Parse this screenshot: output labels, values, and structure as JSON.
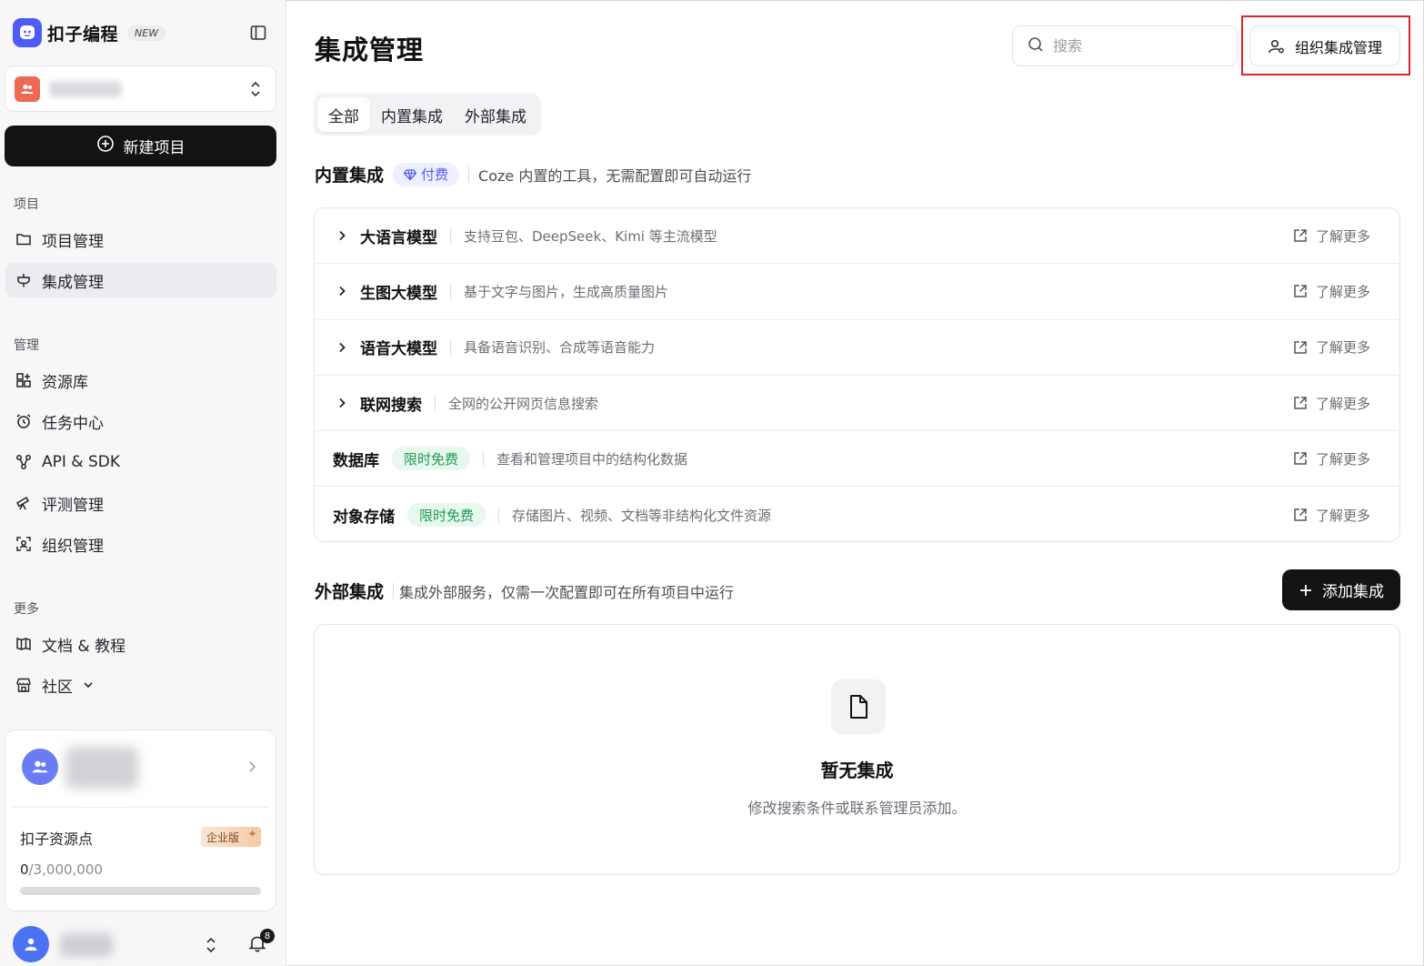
{
  "brand": {
    "name": "扣子编程",
    "badge": "NEW"
  },
  "sidebar": {
    "new_project_label": "新建项目",
    "sections": [
      {
        "title": "项目",
        "items": [
          {
            "label": "项目管理",
            "icon": "folder-icon"
          },
          {
            "label": "集成管理",
            "icon": "plug-icon",
            "active": true
          }
        ]
      },
      {
        "title": "管理",
        "items": [
          {
            "label": "资源库",
            "icon": "grid-plus-icon"
          },
          {
            "label": "任务中心",
            "icon": "alarm-clock-icon"
          },
          {
            "label": "API & SDK",
            "icon": "nodes-icon"
          },
          {
            "label": "评测管理",
            "icon": "telescope-icon"
          },
          {
            "label": "组织管理",
            "icon": "org-scan-icon"
          }
        ]
      },
      {
        "title": "更多",
        "items": [
          {
            "label": "文档 & 教程",
            "icon": "book-icon"
          },
          {
            "label": "社区",
            "icon": "store-icon"
          }
        ]
      }
    ],
    "account": {
      "points_label": "扣子资源点",
      "edition_badge": "企业版",
      "points_used": "0",
      "points_total": "/3,000,000",
      "points_fraction": 0
    },
    "notifications_count": "8"
  },
  "header": {
    "title": "集成管理",
    "search_placeholder": "搜索",
    "org_manage_label": "组织集成管理"
  },
  "tabs": [
    {
      "label": "全部",
      "active": true
    },
    {
      "label": "内置集成"
    },
    {
      "label": "外部集成"
    }
  ],
  "builtin": {
    "title": "内置集成",
    "paid_badge": "付费",
    "desc": "Coze 内置的工具，无需配置即可自动运行",
    "rows": [
      {
        "name": "大语言模型",
        "desc": "支持豆包、DeepSeek、Kimi 等主流模型",
        "expandable": true,
        "learn_more": "了解更多"
      },
      {
        "name": "生图大模型",
        "desc": "基于文字与图片，生成高质量图片",
        "expandable": true,
        "learn_more": "了解更多"
      },
      {
        "name": "语音大模型",
        "desc": "具备语音识别、合成等语音能力",
        "expandable": true,
        "learn_more": "了解更多"
      },
      {
        "name": "联网搜索",
        "desc": "全网的公开网页信息搜索",
        "expandable": true,
        "learn_more": "了解更多"
      },
      {
        "name": "数据库",
        "badge": "限时免费",
        "desc": "查看和管理项目中的结构化数据",
        "expandable": false,
        "learn_more": "了解更多"
      },
      {
        "name": "对象存储",
        "badge": "限时免费",
        "desc": "存储图片、视频、文档等非结构化文件资源",
        "expandable": false,
        "learn_more": "了解更多"
      }
    ]
  },
  "external": {
    "title": "外部集成",
    "desc": "集成外部服务，仅需一次配置即可在所有项目中运行",
    "add_label": "添加集成",
    "empty_title": "暂无集成",
    "empty_desc": "修改搜索条件或联系管理员添加。"
  },
  "colors": {
    "accent": "#4e5bf6",
    "highlight_border": "#d7262f",
    "free_green": "#1d9a56",
    "primary_button": "#131314"
  }
}
